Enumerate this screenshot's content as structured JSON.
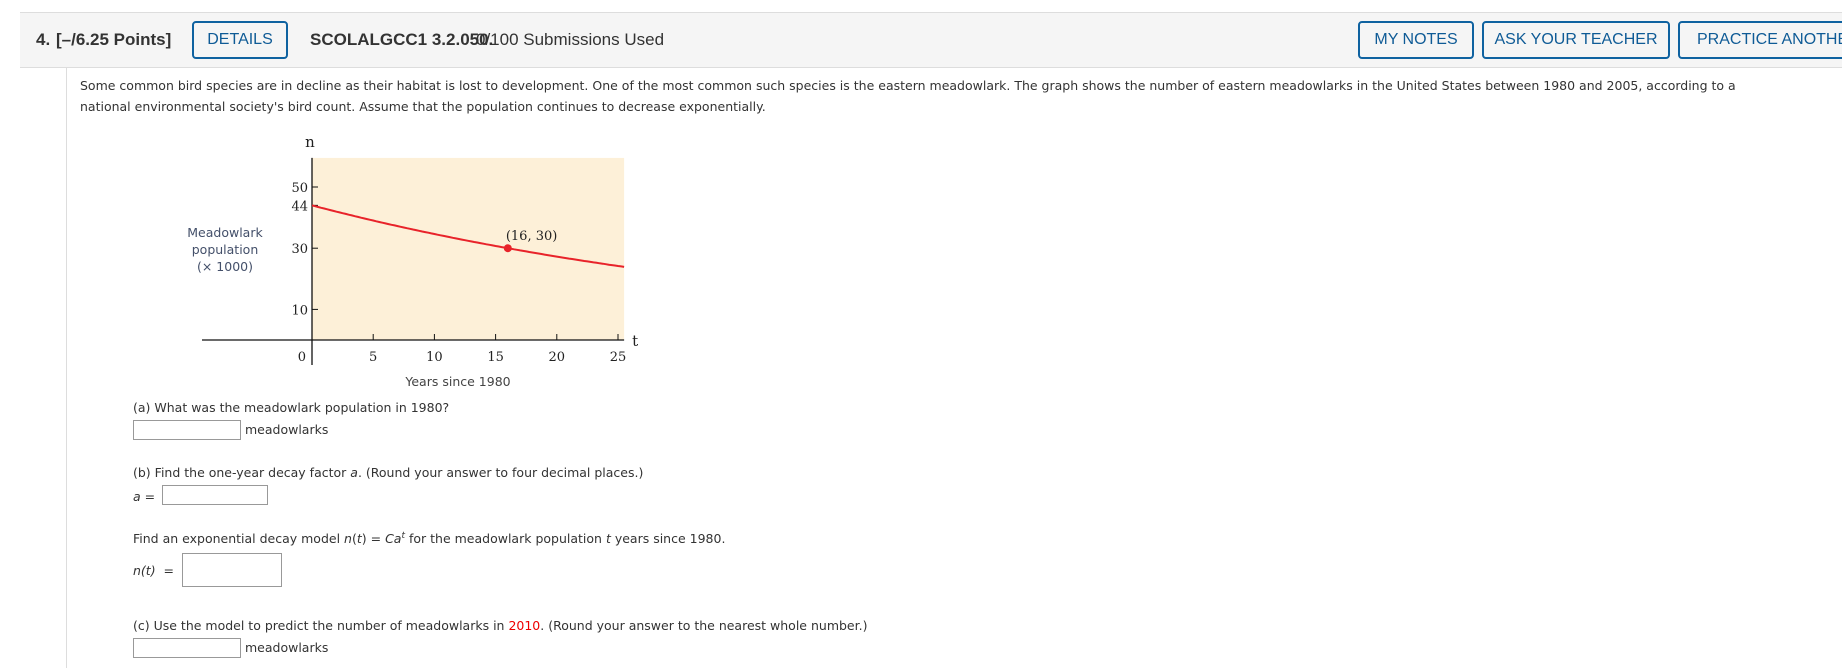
{
  "header": {
    "number": "4.",
    "points": "[–/6.25 Points]",
    "details_label": "DETAILS",
    "problem_id": "SCOLALGCC1 3.2.050.",
    "submissions": "0/100 Submissions Used",
    "my_notes_label": "MY NOTES",
    "ask_teacher_label": "ASK YOUR TEACHER",
    "practice_label": "PRACTICE ANOTHER"
  },
  "intro": {
    "line1": "Some common bird species are in decline as their habitat is lost to development. One of the most common such species is the eastern meadowlark. The graph shows the number of eastern meadowlarks in the United States between 1980 and 2005, according to a",
    "line2": "national environmental society's bird count. Assume that the population continues to decrease exponentially."
  },
  "chart_data": {
    "type": "line",
    "xlabel": "Years since 1980",
    "ylabel_lines": [
      "Meadowlark",
      "population",
      "(× 1000)"
    ],
    "x_axis_var": "t",
    "y_axis_var": "n",
    "x_ticks": [
      5,
      10,
      15,
      20,
      25
    ],
    "y_ticks": [
      10,
      30,
      44,
      50
    ],
    "origin_label": "0",
    "xlim": [
      0,
      25.5
    ],
    "ylim": [
      0,
      59.5
    ],
    "curve": {
      "model": "exponential",
      "t0_value": 44,
      "point": [
        16,
        30
      ]
    },
    "point_label": "(16, 30)",
    "background_color": "#fdf0d8",
    "curve_color": "#e8232a"
  },
  "questions": {
    "a_prompt": "(a) What was the meadowlark population in 1980?",
    "a_unit": "meadowlarks",
    "b_prompt": "(b) Find the one-year decay factor ",
    "b_var": "a",
    "b_suffix": ". (Round your answer to four decimal places.)",
    "b_label": "a =",
    "model_prefix": "Find an exponential decay model ",
    "model_formula_n": "n",
    "model_formula_mid": "(",
    "model_formula_t": "t",
    "model_formula_eq": ") = ",
    "model_formula_C": "Ca",
    "model_formula_sup": "t",
    "model_suffix_1": " for the meadowlark population ",
    "model_suffix_t": "t",
    "model_suffix_2": " years since 1980.",
    "n_label": "n(t)  =",
    "c_prompt_1": "(c) Use the model to predict the number of meadowlarks in ",
    "c_year": "2010",
    "c_prompt_2": ". (Round your answer to the nearest whole number.)",
    "c_unit": "meadowlarks",
    "a_value": "",
    "b_value": "",
    "n_value": "",
    "c_value": ""
  }
}
